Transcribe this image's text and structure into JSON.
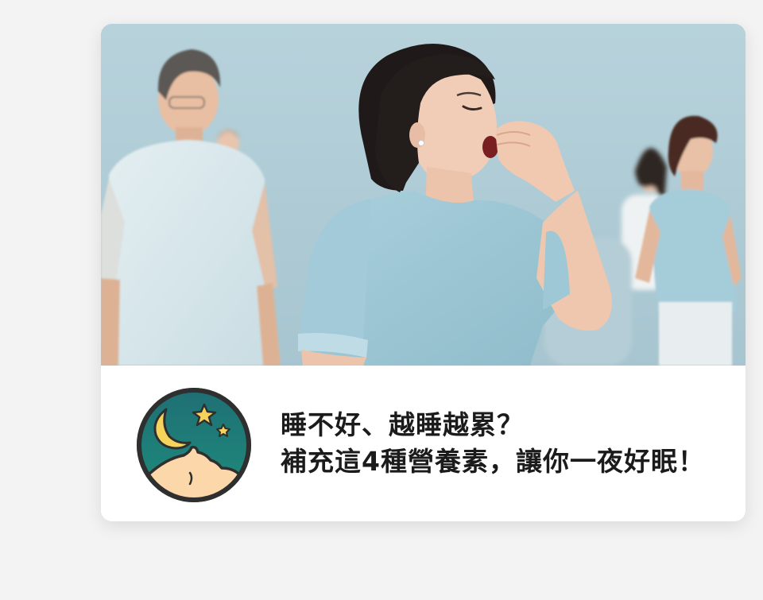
{
  "card": {
    "photo_icon": "photo-woman-yawning-among-adults",
    "badge_icon": "sleep-moon-stars-icon",
    "headline_line1": "睡不好、越睡越累？",
    "headline_line2": "補充這4種營養素，讓你一夜好眠！"
  },
  "colors": {
    "background": "#f3f3f3",
    "card": "#ffffff",
    "badge_ring": "#2f2f2f",
    "badge_sky_top": "#1f6f74",
    "badge_sky_bottom": "#1e8c7c",
    "moon_star": "#f6d35a",
    "face": "#fbd7a9",
    "text": "#1b1b1b"
  }
}
